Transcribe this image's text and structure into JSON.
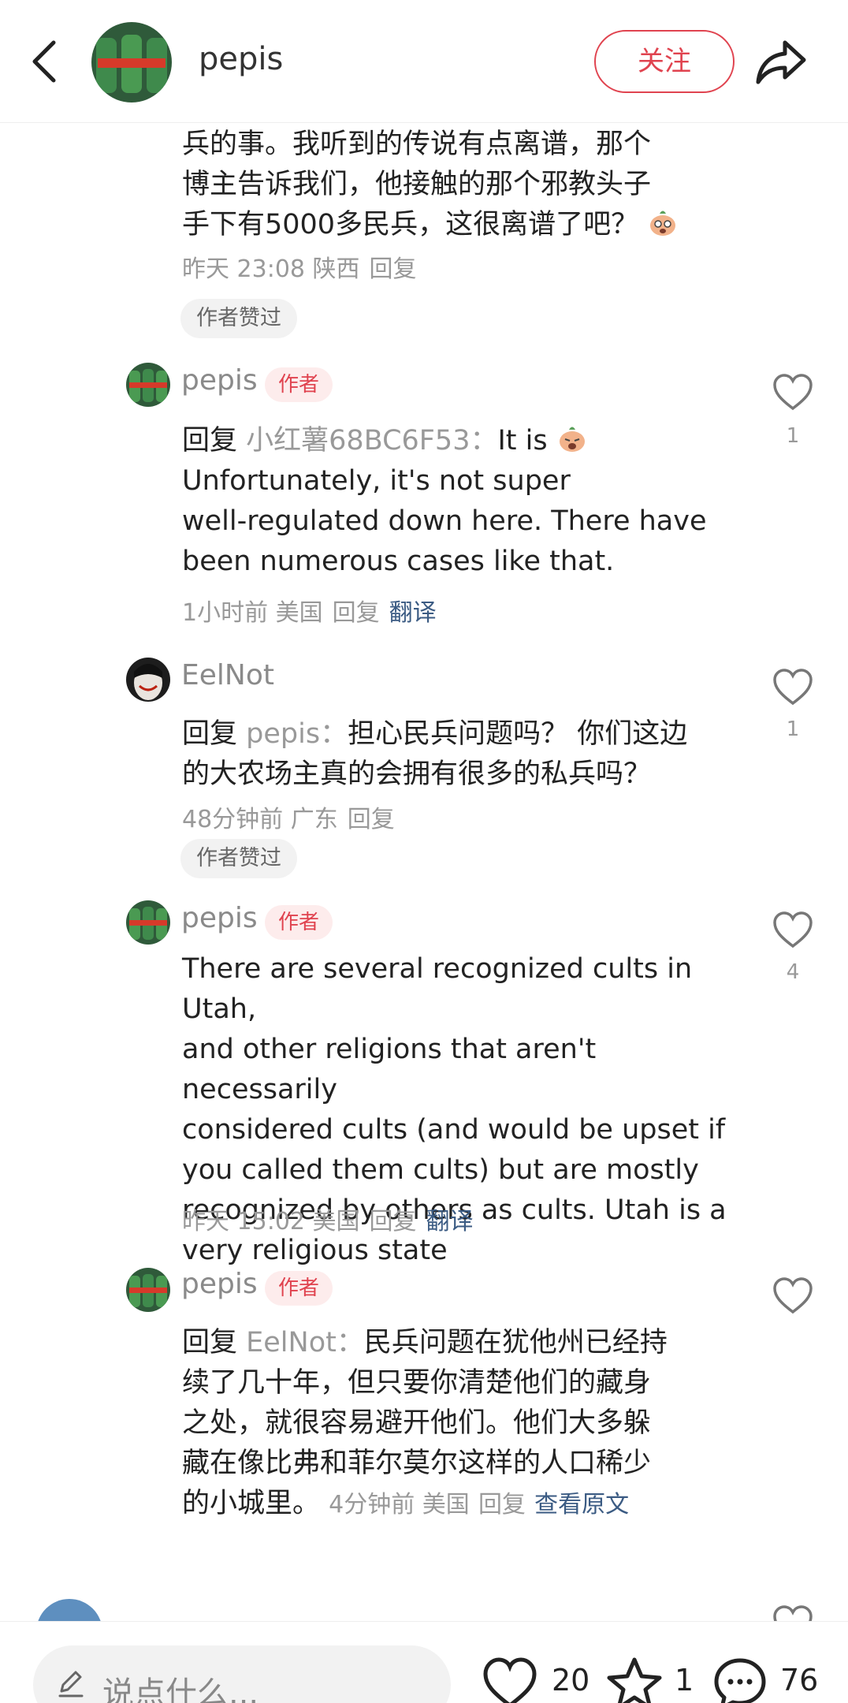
{
  "header": {
    "username": "pepis",
    "follow_label": "关注"
  },
  "comments": [
    {
      "text_lines": [
        "兵的事。我听到的传说有点离谱，那个",
        "博主告诉我们，他接触的那个邪教头子",
        "手下有5000多民兵，这很离谱了吧？"
      ],
      "time": "昨天 23:08",
      "location": "陕西",
      "reply_label": "回复",
      "chip": "作者赞过"
    },
    {
      "username": "pepis",
      "badge": "作者",
      "reply_word": "回复",
      "reply_to": "小红薯68BC6F53：",
      "text_first": "It is",
      "text_lines": [
        "Unfortunately, it's not super",
        "well-regulated down here. There have",
        "been numerous cases like that."
      ],
      "time": "1小时前",
      "location": "美国",
      "reply_label": "回复",
      "translate_label": "翻译",
      "likes": "1"
    },
    {
      "username": "EelNot",
      "reply_word": "回复",
      "reply_to": "pepis：",
      "text_first": "担心民兵问题吗？ 你们这边",
      "text_lines": [
        "的大农场主真的会拥有很多的私兵吗？"
      ],
      "time": "48分钟前",
      "location": "广东",
      "reply_label": "回复",
      "chip": "作者赞过",
      "likes": "1"
    },
    {
      "username": "pepis",
      "badge": "作者",
      "text_lines": [
        "There are several recognized cults in Utah,",
        "and other religions that aren't necessarily",
        "considered cults (and would be upset if",
        "you called them cults) but are mostly",
        "recognized by others as cults. Utah is a",
        "very religious state"
      ],
      "time": "昨天 15:02",
      "location": "美国",
      "reply_label": "回复",
      "translate_label": "翻译",
      "likes": "4"
    },
    {
      "username": "pepis",
      "badge": "作者",
      "reply_word": "回复",
      "reply_to": "EelNot：",
      "text_first": "民兵问题在犹他州已经持",
      "text_lines": [
        "续了几十年，但只要你清楚他们的藏身",
        "之处，就很容易避开他们。他们大多躲",
        "藏在像比弗和菲尔莫尔这样的人口稀少"
      ],
      "text_last": "的小城里。",
      "time": "4分钟前",
      "location": "美国",
      "reply_label": "回复",
      "view_original_label": "查看原文"
    }
  ],
  "bottom_bar": {
    "input_placeholder": "说点什么...",
    "likes": "20",
    "favorites": "1",
    "comments": "76"
  },
  "colors": {
    "accent": "#e0434f",
    "link": "#3b5b83",
    "muted": "#999999"
  },
  "icons": [
    "back-arrow-icon",
    "share-icon",
    "heart-icon",
    "star-icon",
    "comment-bubble-icon",
    "pen-icon",
    "emoji-icon"
  ]
}
